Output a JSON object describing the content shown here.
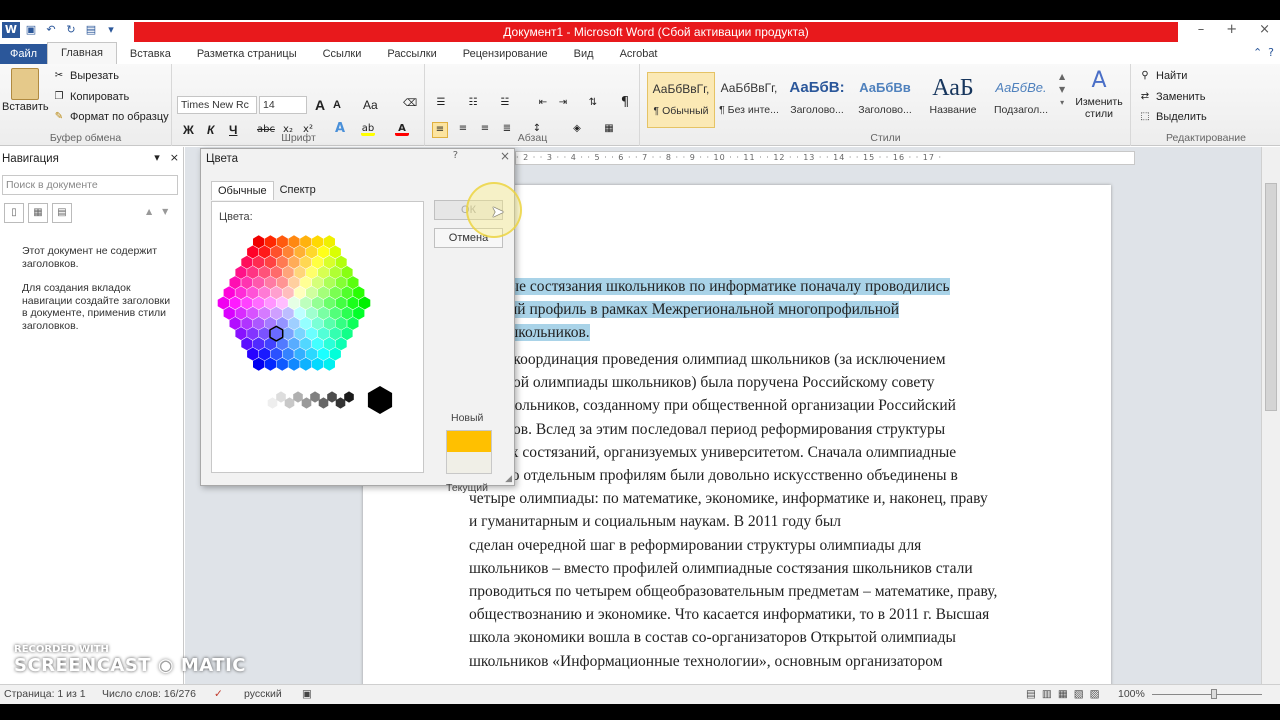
{
  "window": {
    "title": "Документ1 - Microsoft Word (Сбой активации продукта)",
    "title_bar_color": "#e8191c",
    "buttons": [
      "–",
      "+",
      "×"
    ]
  },
  "qat_icons": [
    "word-icon",
    "save-icon",
    "undo-icon",
    "redo-icon",
    "print-preview-icon",
    "customize-qat-icon"
  ],
  "tabs": {
    "file": "Файл",
    "items": [
      "Главная",
      "Вставка",
      "Разметка страницы",
      "Ссылки",
      "Рассылки",
      "Рецензирование",
      "Вид",
      "Acrobat"
    ],
    "active": "Главная"
  },
  "ribbon": {
    "clipboard": {
      "label": "Буфер обмена",
      "paste": "Вставить",
      "cut": "Вырезать",
      "copy": "Копировать",
      "format_painter": "Формат по образцу"
    },
    "font": {
      "label": "Шрифт",
      "font_name": "Times New Rc",
      "font_size": "14",
      "bold": "Ж",
      "italic": "К",
      "underline": "Ч",
      "grow": "A",
      "shrink": "A",
      "case": "Aa"
    },
    "paragraph": {
      "label": "Абзац"
    },
    "styles": {
      "label": "Стили",
      "items": [
        {
          "sample": "АаБбВвГг,",
          "name": "¶ Обычный"
        },
        {
          "sample": "АаБбВвГг,",
          "name": "¶ Без инте..."
        },
        {
          "sample": "АаБбВ:",
          "name": "Заголово..."
        },
        {
          "sample": "АаБбВв",
          "name": "Заголово..."
        },
        {
          "sample": "АаБ",
          "name": "Название"
        },
        {
          "sample": "АаБбВе.",
          "name": "Подзагол..."
        }
      ],
      "change_styles": "Изменить стили"
    },
    "editing": {
      "label": "Редактирование",
      "find": "Найти",
      "replace": "Заменить",
      "select": "Выделить"
    }
  },
  "nav": {
    "title": "Навигация",
    "search_placeholder": "Поиск в документе",
    "text1": "Этот документ не содержит заголовков.",
    "text2": "Для создания вкладок навигации создайте заголовки в документе, применив стили заголовков."
  },
  "ruler": "· 2 · · 3 · · 4 · · 5 · · 6 · · 7 · · 8 · · 9 · · 10 · · 11 · · 12 · · 13 · · 14 · · 15 · · 16 · · 17 ·",
  "document": {
    "para1": [
      "пиадные состязания школьников по информатике  поначалу проводились",
      "дельный профиль в рамках Межрегиональной многопрофильной",
      "иады школьников."
    ],
    "para2": [
      "8 году координация проведения  олимпиад школьников (за исключением",
      "ссийской олимпиады школьников) была поручена Российскому совету",
      "иад школьников, созданному при общественной организации Российский",
      "ректоров. Вслед за этим последовал период реформирования структуры",
      "иадных состязаний, организуемых университетом. Сначала олимпиадные",
      "ания по отдельным профилям были довольно искусственно объединены в",
      "четыре олимпиады: по математике, экономике, информатике и, наконец, праву",
      "и гуманитарным и социальным наукам. В 2011 году был",
      "сделан  очередной  шаг  в реформировании структуры олимпиады для",
      "школьников – вместо профилей олимпиадные состязания школьников стали",
      "проводиться по четырем общеобразовательным предметам – математике, праву,",
      "обществознанию и экономике. Что касается информатики, то в 2011 г. Высшая",
      "школа экономики вошла в состав со-организаторов Открытой олимпиады",
      "школьников «Информационные технологии», основным организатором"
    ],
    "highlight_color": "#a9d3e8"
  },
  "status": {
    "page": "Страница: 1 из 1",
    "words": "Число слов: 16/276",
    "language": "русский",
    "zoom": "100%",
    "zoom_level": 1.0
  },
  "dialog": {
    "title": "Цвета",
    "help": "?",
    "close": "×",
    "tab_standard": "Обычные",
    "tab_custom": "Спектр",
    "colors_label": "Цвета:",
    "ok": "ОК",
    "cancel": "Отмена",
    "new_label": "Новый",
    "current_label": "Текущий",
    "new_color": "#ffc000",
    "current_color": "#f0efe7"
  },
  "watermark": {
    "line1": "RECORDED WITH",
    "line2": "SCREENCAST",
    "line3": "MATIC"
  }
}
